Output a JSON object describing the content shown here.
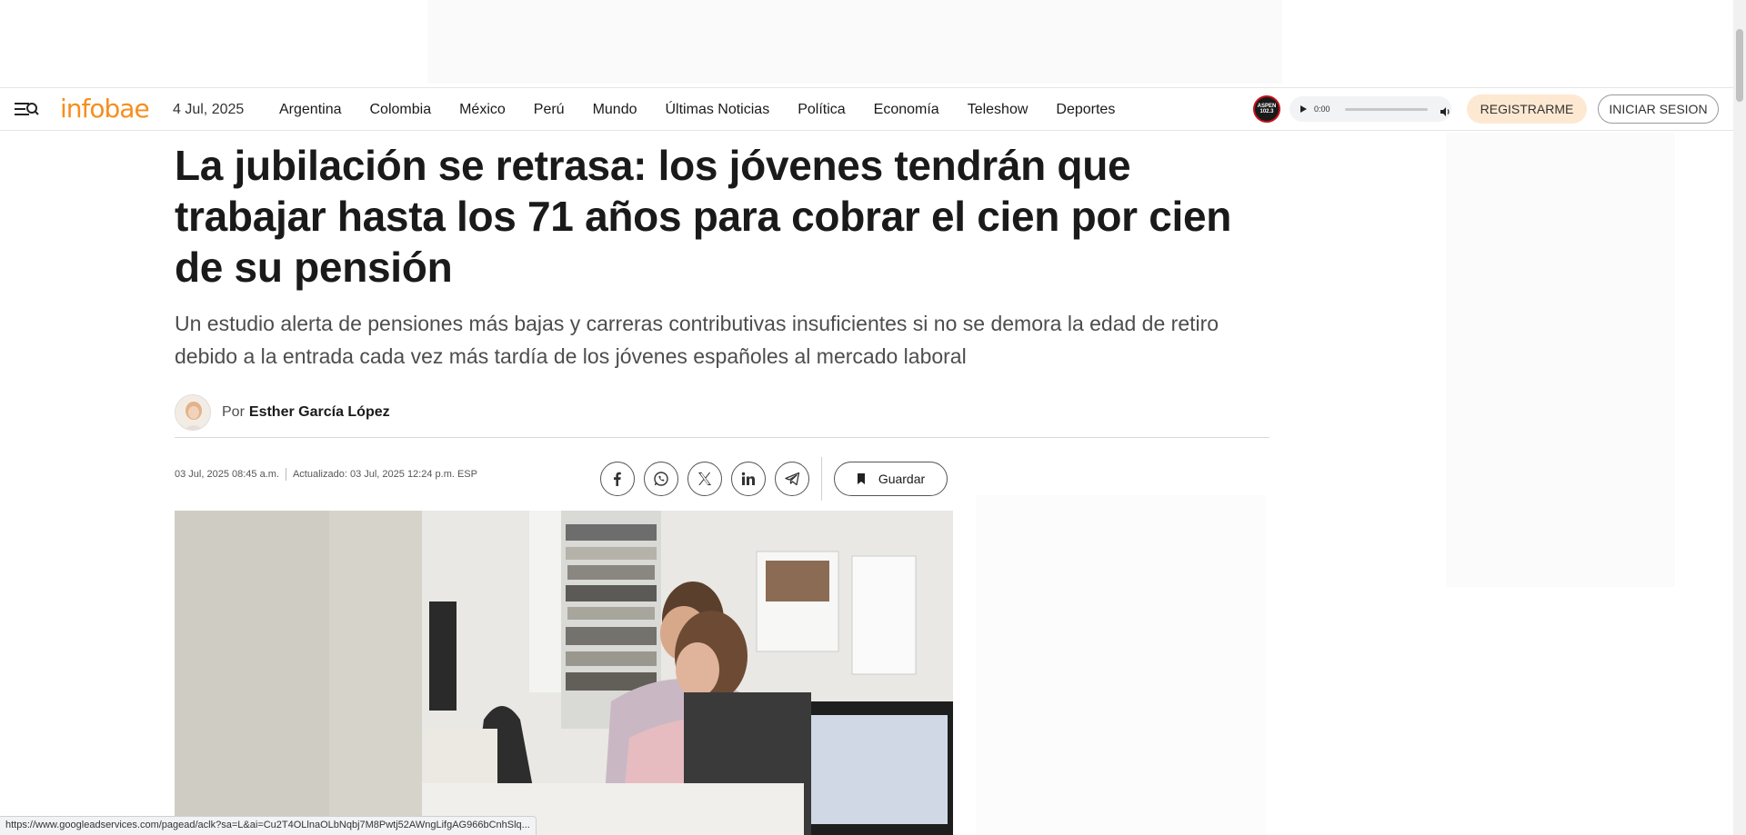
{
  "header": {
    "logo": "infobae",
    "date": "4 Jul, 2025",
    "nav": [
      "Argentina",
      "Colombia",
      "México",
      "Perú",
      "Mundo",
      "Últimas Noticias",
      "Política",
      "Economía",
      "Teleshow",
      "Deportes"
    ],
    "radio_logo": "ASPEN 102.3",
    "player_time": "0:00",
    "register_label": "REGISTRARME",
    "login_label": "INICIAR SESION"
  },
  "article": {
    "headline": "La jubilación se retrasa: los jóvenes tendrán que trabajar hasta los 71 años para cobrar el cien por cien de su pensión",
    "subhead": "Un estudio alerta de pensiones más bajas y carreras contributivas insuficientes si no se demora la edad de retiro debido a la entrada cada vez más tardía de los jóvenes españoles al mercado laboral",
    "author_prefix": "Por",
    "author_name": "Esther García López",
    "published": "03 Jul, 2025 08:45 a.m.",
    "updated": "Actualizado: 03 Jul, 2025 12:24 p.m. ESP",
    "save_label": "Guardar"
  },
  "share_icons": [
    "facebook-icon",
    "whatsapp-icon",
    "x-icon",
    "linkedin-icon",
    "telegram-icon"
  ],
  "status_bar": {
    "url": "https://www.googleadservices.com/pagead/aclk?sa=L&ai=Cu2T4OLlnaOLbNqbj7M8Pwtj52AWngLifgAG966bCnhSlq..."
  },
  "colors": {
    "brand": "#f68e1e",
    "register_bg": "#fde9d2"
  }
}
